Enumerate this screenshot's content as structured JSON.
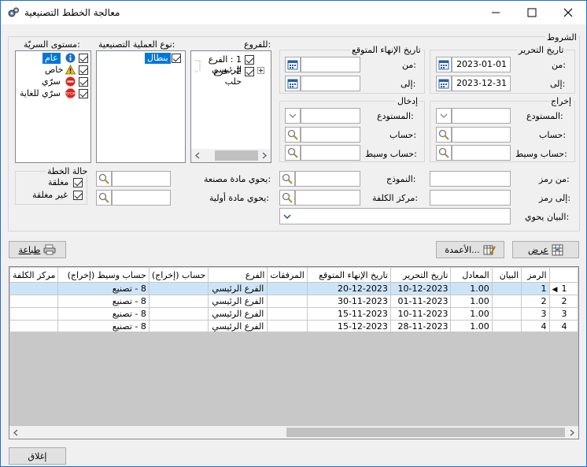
{
  "window": {
    "title": "معالجة الخطط التصنيعية",
    "minimize": "—",
    "maximize": "☐",
    "close": "✕"
  },
  "conditions": {
    "group_label": "الشروط",
    "edit_date": {
      "label": "تاريخ التحرير",
      "from_label": "من:",
      "to_label": "إلى:",
      "from": "2023-01-01",
      "to": "2023-12-31"
    },
    "end_date": {
      "label": "تاريخ الإنهاء المتوقع",
      "from_label": "من:",
      "to_label": "إلى:",
      "from": "",
      "to": ""
    },
    "output": {
      "label": "إخراج",
      "warehouse_label": "المستودع:",
      "account_label": "حساب:",
      "mid_account_label": "حساب وسيط:"
    },
    "input": {
      "label": "إدخال",
      "warehouse_label": "المستودع:",
      "account_label": "حساب:",
      "mid_account_label": "حساب وسيط:"
    },
    "from_code_label": "من رمز:",
    "to_code_label": "إلى رمز:",
    "template_label": "النموذج:",
    "cost_center_label": "مركز الكلفة:",
    "statement_label": "البيان يحوي:",
    "contains_product_label": "يحوي مادة مصنعة:",
    "contains_raw_label": "يحوي مادة أولية:"
  },
  "branches": {
    "label": "للفروع:",
    "items": [
      "1 : الفرع الرئيسي",
      "2 : فرع حلب"
    ]
  },
  "process_types": {
    "label": "نوع العملية التصنيعية:",
    "items": [
      "بنطال"
    ]
  },
  "secrecy": {
    "label": "مستوى السريّة:",
    "items": [
      "عام",
      "خاص",
      "سرّي",
      "سرّي للغاية"
    ]
  },
  "plan_status": {
    "label": "حالة الخطة",
    "closed": "مغلقة",
    "not_closed": "غير مغلقة"
  },
  "buttons": {
    "print": "طباعة",
    "columns": "الأعمدة...",
    "show": "عرض",
    "close": "إغلاق"
  },
  "grid": {
    "columns": [
      "الرمز",
      "البيان",
      "المعادل",
      "تاريخ التحرير",
      "تاريخ الإنهاء المتوقع",
      "المرفقات",
      "الفرع",
      "حساب (إخراج)",
      "حساب وسيط (إخراج)",
      "مركز الكلفة"
    ],
    "rows": [
      {
        "num": "1",
        "code": "1",
        "statement": "",
        "equiv": "1.00",
        "edit_date": "10-12-2023",
        "end_date": "20-12-2023",
        "attach": "",
        "branch": "الفرع الرئيسي",
        "account": "",
        "mid_account": "8 - تصنيع",
        "cost_center": ""
      },
      {
        "num": "2",
        "code": "2",
        "statement": "",
        "equiv": "1.00",
        "edit_date": "01-11-2023",
        "end_date": "30-11-2023",
        "attach": "",
        "branch": "الفرع الرئيسي",
        "account": "",
        "mid_account": "8 - تصنيع",
        "cost_center": ""
      },
      {
        "num": "3",
        "code": "3",
        "statement": "",
        "equiv": "1.00",
        "edit_date": "10-11-2023",
        "end_date": "15-11-2023",
        "attach": "",
        "branch": "الفرع الرئيسي",
        "account": "",
        "mid_account": "8 - تصنيع",
        "cost_center": ""
      },
      {
        "num": "4",
        "code": "4",
        "statement": "",
        "equiv": "1.00",
        "edit_date": "28-11-2023",
        "end_date": "15-12-2023",
        "attach": "",
        "branch": "الفرع الرئيسي",
        "account": "",
        "mid_account": "8 - تصنيع",
        "cost_center": ""
      }
    ]
  },
  "colors": {
    "selected_row": "#cce4f7",
    "title_border": "#1e6fd0",
    "selection": "#0078d7"
  }
}
